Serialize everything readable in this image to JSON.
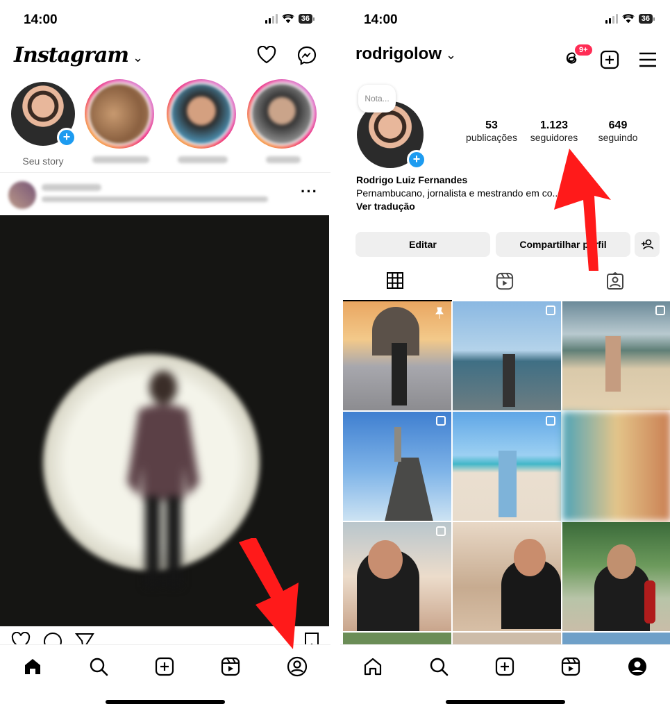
{
  "left": {
    "status": {
      "time": "14:00",
      "battery": "36"
    },
    "header": {
      "logo": "Instagram"
    },
    "stories": [
      {
        "label": "Seu story"
      }
    ],
    "tabbar": [
      "home",
      "search",
      "new-post",
      "reels",
      "profile"
    ]
  },
  "right": {
    "status": {
      "time": "14:00",
      "battery": "36"
    },
    "header": {
      "username": "rodrigolow",
      "threads_badge": "9+"
    },
    "note": "Nota...",
    "stats": [
      {
        "value": "53",
        "label": "publicações"
      },
      {
        "value": "1.123",
        "label": "seguidores"
      },
      {
        "value": "649",
        "label": "seguindo"
      }
    ],
    "bio": {
      "name": "Rodrigo Luiz Fernandes",
      "text": "Pernambucano, jornalista e mestrando em co... ação.",
      "translate": "Ver tradução"
    },
    "buttons": {
      "edit": "Editar",
      "share": "Compartilhar perfil"
    },
    "tabs": [
      "grid",
      "reels",
      "tagged"
    ],
    "tabbar": [
      "home",
      "search",
      "new-post",
      "reels",
      "profile"
    ]
  },
  "colors": {
    "accent": "#1d9bf0",
    "badge": "#ff2d55",
    "arrow": "#ff1a1a"
  }
}
